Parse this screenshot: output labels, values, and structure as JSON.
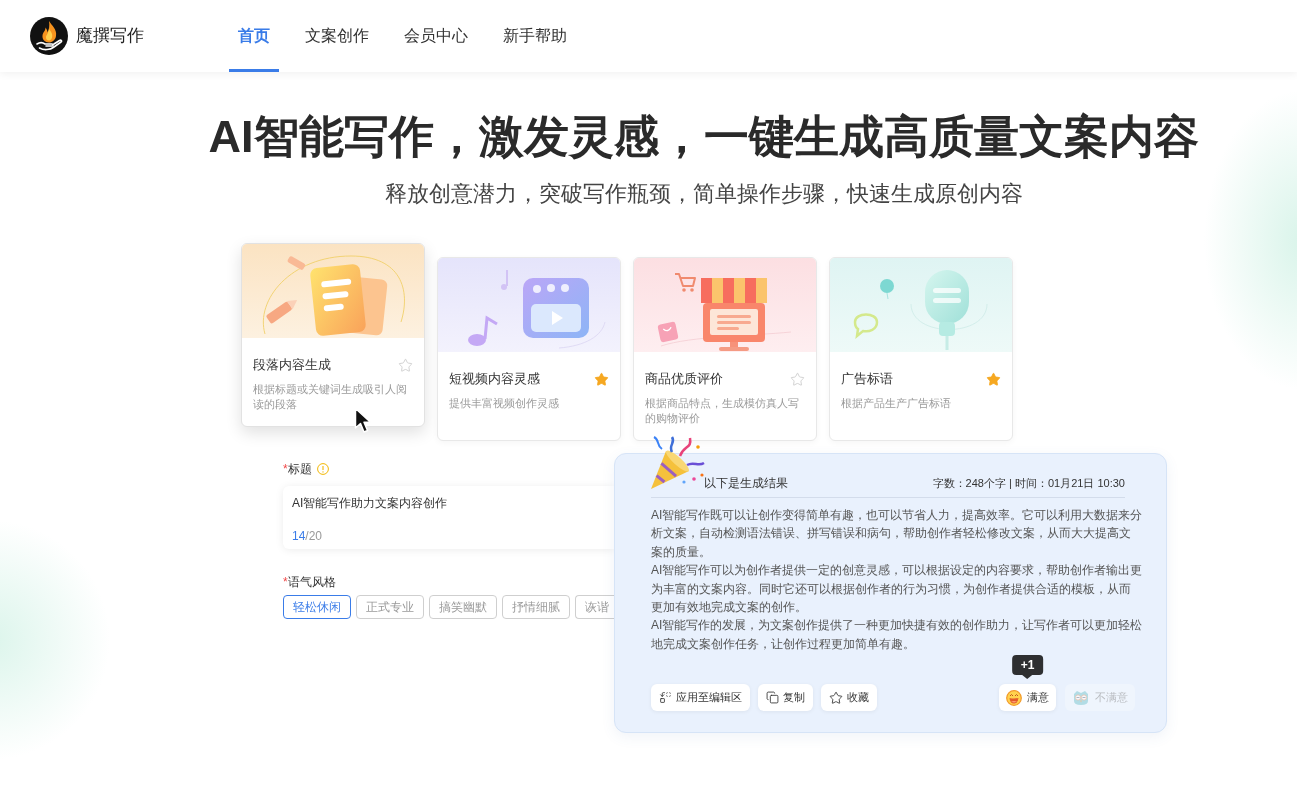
{
  "header": {
    "brand": "魔撰写作",
    "nav": [
      {
        "label": "首页",
        "selected": true
      },
      {
        "label": "文案创作",
        "selected": false
      },
      {
        "label": "会员中心",
        "selected": false
      },
      {
        "label": "新手帮助",
        "selected": false
      }
    ]
  },
  "hero": {
    "title": "AI智能写作，激发灵感，一键生成高质量文案内容",
    "subtitle": "释放创意潜力，突破写作瓶颈，简单操作步骤，快速生成原创内容"
  },
  "templates": [
    {
      "kind": "paragraph",
      "title": "段落内容生成",
      "description": "根据标题或关键词生成吸引人阅读的段落",
      "starred": false,
      "selected": true
    },
    {
      "kind": "video",
      "title": "短视频内容灵感",
      "description": "提供丰富视频创作灵感",
      "starred": true,
      "selected": false
    },
    {
      "kind": "review",
      "title": "商品优质评价",
      "description": "根据商品特点，生成模仿真人写的购物评价",
      "starred": false,
      "selected": false
    },
    {
      "kind": "slogan",
      "title": "广告标语",
      "description": "根据产品生产广告标语",
      "starred": true,
      "selected": false
    }
  ],
  "form": {
    "title_field": {
      "required_mark": "*",
      "label": "标题",
      "value": "AI智能写作助力文案内容创作",
      "count": "14",
      "limit": "/20"
    },
    "tone": {
      "required_mark": "*",
      "label": "语气风格",
      "options": [
        {
          "label": "轻松休闲",
          "selected": true
        },
        {
          "label": "正式专业",
          "selected": false
        },
        {
          "label": "搞笑幽默",
          "selected": false
        },
        {
          "label": "抒情细腻",
          "selected": false
        },
        {
          "label": "诙谐",
          "selected": false
        }
      ]
    }
  },
  "result": {
    "heading": "以下是生成结果",
    "meta": "字数：248个字 | 时间：01月21日 10:30",
    "paragraphs": [
      "AI智能写作既可以让创作变得简单有趣，也可以节省人力，提高效率。它可以利用大数据来分析文案，自动检测语法错误、拼写错误和病句，帮助创作者轻松修改文案，从而大大提高文案的质量。",
      "AI智能写作可以为创作者提供一定的创意灵感，可以根据设定的内容要求，帮助创作者输出更为丰富的文案内容。同时它还可以根据创作者的行为习惯，为创作者提供合适的模板，从而更加有效地完成文案的创作。",
      "AI智能写作的发展，为文案创作提供了一种更加快捷有效的创作助力，让写作者可以更加轻松地完成文案创作任务，让创作过程更加简单有趣。"
    ],
    "actions": [
      {
        "kind": "apply",
        "label": "应用至编辑区"
      },
      {
        "kind": "copy",
        "label": "复制"
      },
      {
        "kind": "favorite",
        "label": "收藏"
      }
    ],
    "feedback": [
      {
        "kind": "satisfied",
        "label": "满意",
        "selected": true,
        "tooltip": "+1"
      },
      {
        "kind": "unsatisfied",
        "label": "不满意",
        "selected": false
      }
    ]
  }
}
